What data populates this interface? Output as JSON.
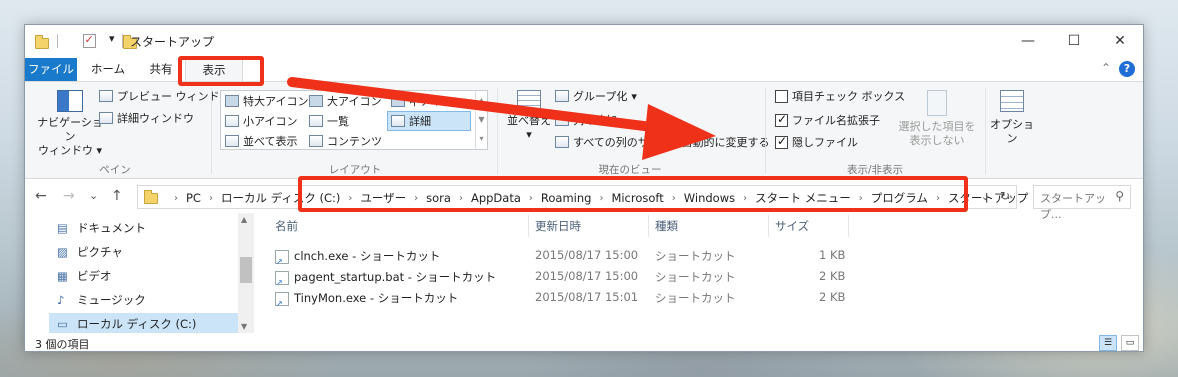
{
  "window": {
    "title": "スタートアップ",
    "qa_dropdown": "▾",
    "controls": {
      "minimize": "—",
      "maximize": "☐",
      "close": "✕"
    }
  },
  "tabs": [
    "ファイル",
    "ホーム",
    "共有",
    "表示"
  ],
  "help": "?",
  "ribbon": {
    "pane": {
      "nav_pane_l1": "ナビゲーション",
      "nav_pane_l2": "ウィンドウ",
      "preview": "プレビュー ウィンドウ",
      "details": "詳細ウィンドウ",
      "label": "ペイン"
    },
    "layout": {
      "items": [
        "特大アイコン",
        "大アイコン",
        "中アイコン",
        "小アイコン",
        "一覧",
        "詳細",
        "並べて表示",
        "コンテンツ"
      ],
      "label": "レイアウト"
    },
    "current_view": {
      "sort": "並べ替え",
      "group": "グループ化",
      "add_columns": "列の追加",
      "autosize": "すべての列のサイズを自動的に変更する",
      "label": "現在のビュー"
    },
    "show_hide": {
      "item_checkboxes": "項目チェック ボックス",
      "file_ext": "ファイル名拡張子",
      "hidden": "隠しファイル",
      "hide_sel_l1": "選択した項目を",
      "hide_sel_l2": "表示しない",
      "label": "表示/非表示"
    },
    "options": "オプション"
  },
  "nav": {
    "back": "←",
    "forward": "→",
    "recent": "⌄",
    "up": "↑",
    "breadcrumb": [
      "PC",
      "ローカル ディスク (C:)",
      "ユーザー",
      "sora",
      "AppData",
      "Roaming",
      "Microsoft",
      "Windows",
      "スタート メニュー",
      "プログラム",
      "スタートアップ"
    ],
    "crumb_sep": "›",
    "refresh": "↻",
    "search_placeholder": "スタートアップ...",
    "search_icon": "search-icon"
  },
  "sidebar": [
    {
      "label": "ドキュメント",
      "icon": "documents-icon"
    },
    {
      "label": "ピクチャ",
      "icon": "pictures-icon"
    },
    {
      "label": "ビデオ",
      "icon": "videos-icon"
    },
    {
      "label": "ミュージック",
      "icon": "music-icon"
    },
    {
      "label": "ローカル ディスク (C:)",
      "icon": "drive-icon"
    }
  ],
  "columns": [
    "名前",
    "更新日時",
    "種類",
    "サイズ"
  ],
  "files": [
    {
      "name": "clnch.exe - ショートカット",
      "date": "2015/08/17 15:00",
      "type": "ショートカット",
      "size": "1 KB"
    },
    {
      "name": "pagent_startup.bat - ショートカット",
      "date": "2015/08/17 15:00",
      "type": "ショートカット",
      "size": "2 KB"
    },
    {
      "name": "TinyMon.exe - ショートカット",
      "date": "2015/08/17 15:01",
      "type": "ショートカット",
      "size": "2 KB"
    }
  ],
  "status": "3 個の項目",
  "colors": {
    "accent": "#1979ca",
    "highlight": "#f0311a",
    "selection": "#cce4f7"
  }
}
